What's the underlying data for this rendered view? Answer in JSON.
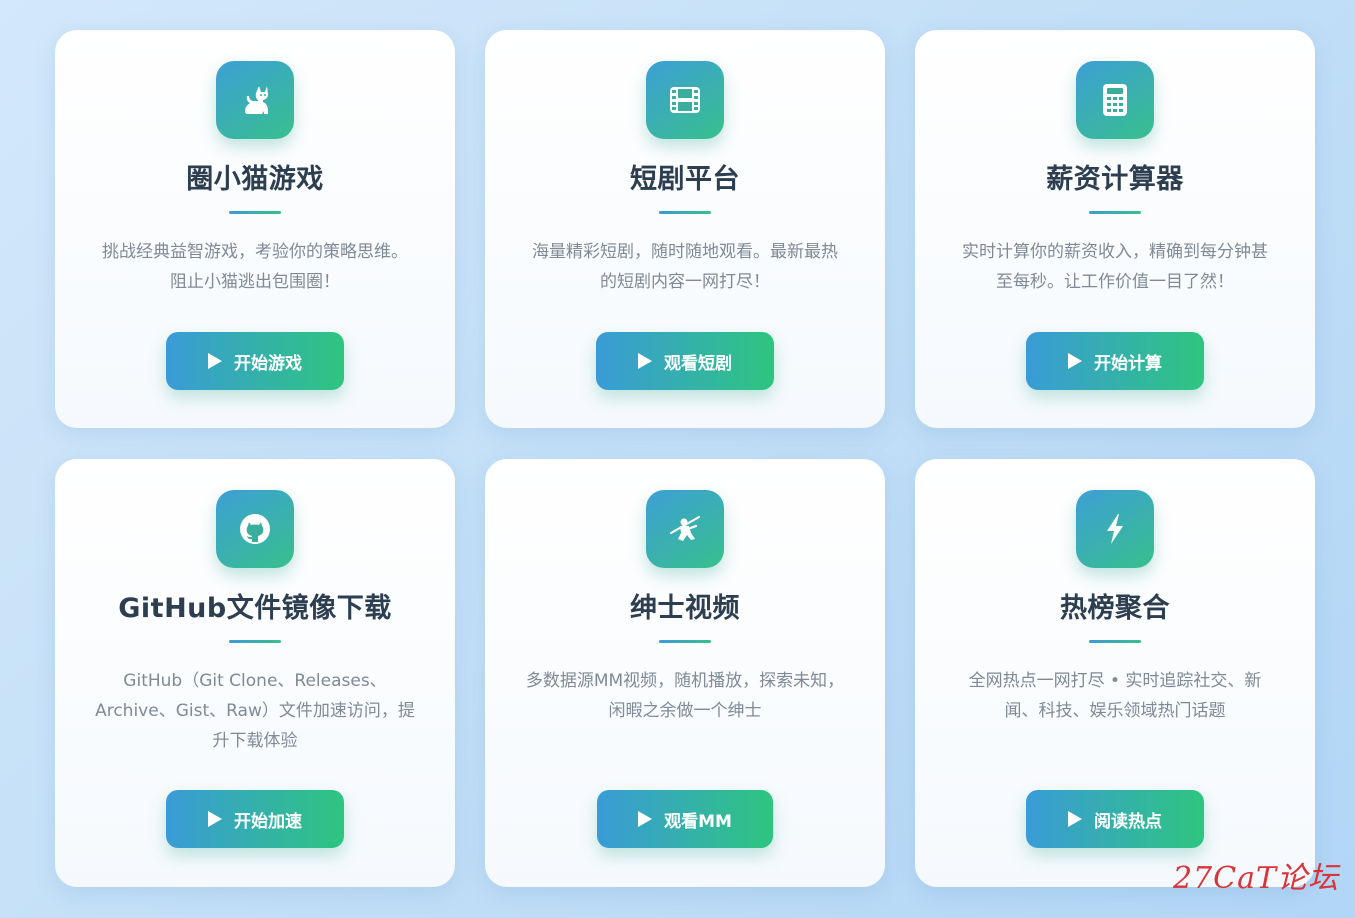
{
  "cards": [
    {
      "title": "圈小猫游戏",
      "icon": "cat-icon",
      "description": "挑战经典益智游戏，考验你的策略思维。阻止小猫逃出包围圈！",
      "button": "开始游戏"
    },
    {
      "title": "短剧平台",
      "icon": "film-icon",
      "description": "海量精彩短剧，随时随地观看。最新最热的短剧内容一网打尽！",
      "button": "观看短剧"
    },
    {
      "title": "薪资计算器",
      "icon": "calculator-icon",
      "description": "实时计算你的薪资收入，精确到每分钟甚至每秒。让工作价值一目了然！",
      "button": "开始计算"
    },
    {
      "title": "GitHub文件镜像下载",
      "icon": "github-icon",
      "description": "GitHub（Git Clone、Releases、Archive、Gist、Raw）文件加速访问，提升下载体验",
      "button": "开始加速"
    },
    {
      "title": "绅士视频",
      "icon": "ninja-icon",
      "description": "多数据源MM视频，随机播放，探索未知，闲暇之余做一个绅士",
      "button": "观看MM"
    },
    {
      "title": "热榜聚合",
      "icon": "lightning-icon",
      "description": "全网热点一网打尽 • 实时追踪社交、新闻、科技、娱乐领域热门话题",
      "button": "阅读热点"
    }
  ],
  "watermark": "27CaT论坛",
  "colors": {
    "gradient_start": "#3a9bd7",
    "gradient_end": "#2ec57f",
    "title": "#2c3e50",
    "description": "#7f8a96",
    "watermark": "#d8343a"
  }
}
